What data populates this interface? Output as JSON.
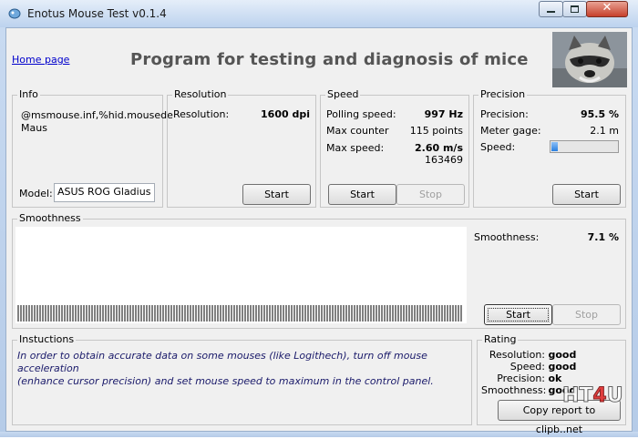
{
  "window": {
    "title": "Enotus Mouse Test v0.1.4",
    "minimize": "−",
    "maximize": "□",
    "close": "✕"
  },
  "header": {
    "home_link": "Home page",
    "headline": "Program for testing and diagnosis of mice"
  },
  "info": {
    "title": "Info",
    "lines": [
      "@msmouse.inf,%hid.mousede",
      "Maus"
    ],
    "model_label": "Model:",
    "model_value": "ASUS ROG Gladius"
  },
  "resolution": {
    "title": "Resolution",
    "label": "Resolution:",
    "value": "1600 dpi",
    "start": "Start"
  },
  "speed": {
    "title": "Speed",
    "polling_label": "Polling speed:",
    "polling_value": "997 Hz",
    "counter_label": "Max counter",
    "counter_value": "115 points",
    "maxspeed_label": "Max  speed:",
    "maxspeed_value": "2.60 m/s",
    "extra_value": "163469",
    "start": "Start",
    "stop": "Stop"
  },
  "precision": {
    "title": "Precision",
    "precision_label": "Precision:",
    "precision_value": "95.5 %",
    "gage_label": "Meter gage:",
    "gage_value": "2.1 m",
    "speed_label": "Speed:",
    "speed_fraction": 0.1,
    "start": "Start"
  },
  "smoothness": {
    "title": "Smoothness",
    "label": "Smoothness:",
    "value": "7.1 %",
    "start": "Start",
    "stop": "Stop"
  },
  "instructions": {
    "title": "Instuctions",
    "text_line1": "In order to obtain accurate data on some mouses (like Logithech), turn off mouse acceleration",
    "text_line2": "(enhance cursor precision) and set mouse speed to maximum in the control panel."
  },
  "rating": {
    "title": "Rating",
    "rows": [
      {
        "label": "Resolution:",
        "value": "good"
      },
      {
        "label": "Speed:",
        "value": "good"
      },
      {
        "label": "Precision:",
        "value": "ok"
      },
      {
        "label": "Smoothness:",
        "value": "good"
      }
    ],
    "copy_button": "Copy report to clipb..net"
  },
  "watermark": {
    "prefix": "HT",
    "four": "4",
    "suffix": "U"
  },
  "icons": {
    "app": "mouse-app-icon",
    "photo": "raccoon-photo"
  }
}
